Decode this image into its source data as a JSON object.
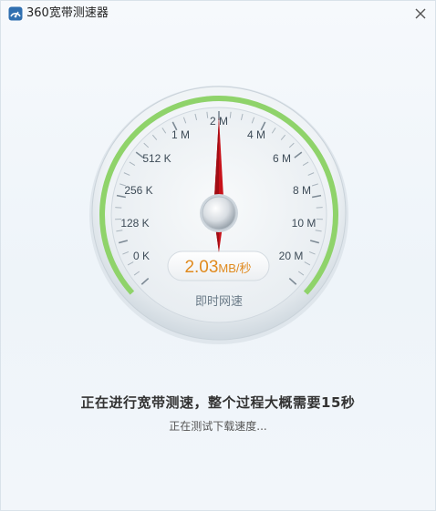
{
  "window": {
    "title": "360宽带测速器",
    "close_icon": "close-icon",
    "app_icon": "app-logo-icon"
  },
  "gauge": {
    "scale_labels": [
      "0 K",
      "128 K",
      "256 K",
      "512 K",
      "1 M",
      "2 M",
      "4 M",
      "6 M",
      "8 M",
      "10 M",
      "20 M"
    ],
    "speed_value": "2.03",
    "speed_unit": "MB/秒",
    "caption": "即时网速",
    "progress_color": "#8fd36a",
    "needle_color": "#c8121a",
    "speed_color": "#e08a1e"
  },
  "status": {
    "main": "正在进行宽带测速，整个过程大概需要15秒",
    "sub": "正在测试下载速度..."
  }
}
